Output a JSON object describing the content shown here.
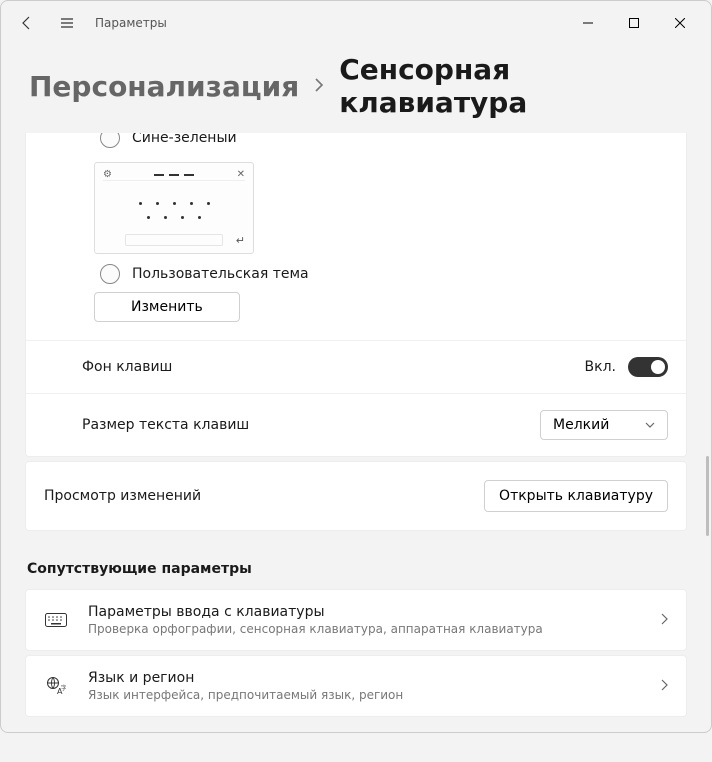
{
  "header": {
    "app_title": "Параметры"
  },
  "breadcrumb": {
    "parent": "Персонализация",
    "current": "Сенсорная клавиатура"
  },
  "themes": {
    "partial_label": "Сине-зеленый",
    "custom_label": "Пользовательская тема",
    "change_button": "Изменить"
  },
  "key_background": {
    "label": "Фон клавиш",
    "state_label": "Вкл.",
    "on": true
  },
  "key_text_size": {
    "label": "Размер текста клавиш",
    "selected": "Мелкий"
  },
  "preview": {
    "label": "Просмотр изменений",
    "button": "Открыть клавиатуру"
  },
  "related": {
    "heading": "Сопутствующие параметры",
    "typing": {
      "title": "Параметры ввода с клавиатуры",
      "desc": "Проверка орфографии, сенсорная клавиатура, аппаратная клавиатура"
    },
    "language": {
      "title": "Язык и регион",
      "desc": "Язык интерфейса, предпочитаемый язык, регион"
    }
  }
}
